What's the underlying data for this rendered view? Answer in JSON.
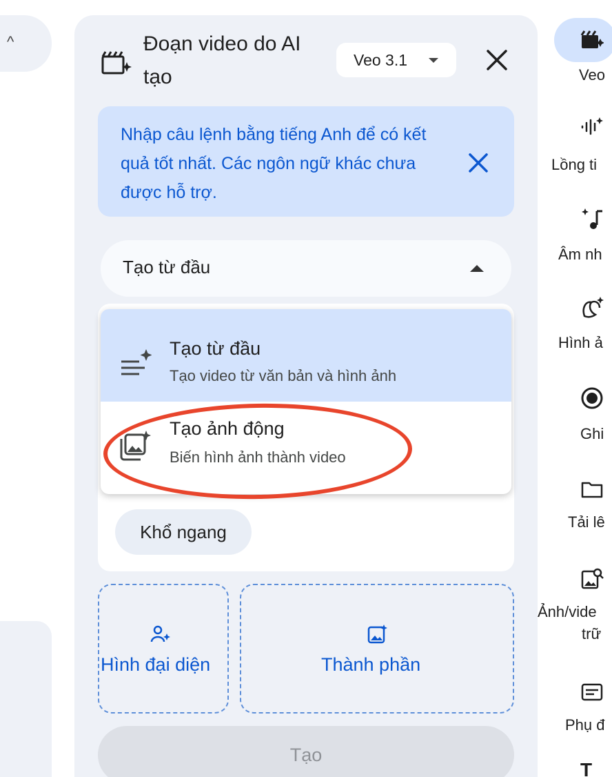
{
  "header": {
    "title": "Đoạn video do AI tạo",
    "model": "Veo 3.1"
  },
  "banner": {
    "text": "Nhập câu lệnh bằng tiếng Anh để có kết quả tốt nhất. Các ngôn ngữ khác chưa được hỗ trợ."
  },
  "mode_select": {
    "value": "Tạo từ đầu"
  },
  "mode_menu": {
    "items": [
      {
        "title": "Tạo từ đầu",
        "subtitle": "Tạo video từ văn bản và hình ảnh",
        "icon": "text-sparkle-icon",
        "selected": true
      },
      {
        "title": "Tạo ảnh động",
        "subtitle": "Biến hình ảnh thành video",
        "icon": "photo-sparkle-icon",
        "selected": false
      }
    ]
  },
  "aspect_chip": "Khổ ngang",
  "inputs": {
    "avatar_label": "Hình đại diện",
    "ingredients_label": "Thành phần"
  },
  "generate_label": "Tạo",
  "rail": {
    "items": [
      {
        "label": "Veo",
        "icon": "veo-clapper-icon"
      },
      {
        "label": "Lồng ti",
        "icon": "audio-sparkle-icon"
      },
      {
        "label": "Âm nh",
        "icon": "music-sparkle-icon"
      },
      {
        "label": "Hình ả",
        "icon": "banana-icon"
      },
      {
        "label": "Ghi",
        "icon": "record-icon"
      },
      {
        "label": "Tải lê",
        "icon": "folder-icon"
      },
      {
        "label": "Ảnh/vide",
        "label2": "trữ",
        "icon": "image-search-icon"
      },
      {
        "label": "Phụ đ",
        "icon": "subtitles-icon"
      },
      {
        "label": "T",
        "icon": "text-icon"
      }
    ]
  },
  "colors": {
    "accent": "#0b57d0",
    "banner_bg": "#d3e3fd",
    "panel_bg": "#eef1f7",
    "highlight": "#e8452c"
  }
}
